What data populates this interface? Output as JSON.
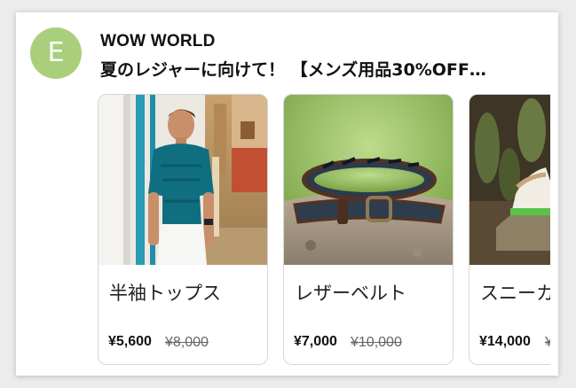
{
  "ad": {
    "avatar_letter": "E",
    "avatar_color": "#a9cf7d",
    "brand": "WOW WORLD",
    "headline": "夏のレジャーに向けて！ 【メンズ用品30%OFF…"
  },
  "products": [
    {
      "name": "半袖トップス",
      "price": "¥5,600",
      "old_price": "¥8,000",
      "image": "man-in-teal-shirt-photo"
    },
    {
      "name": "レザーベルト",
      "price": "¥7,000",
      "old_price": "¥10,000",
      "image": "leather-belt-photo"
    },
    {
      "name": "スニーカー",
      "price": "¥14,000",
      "old_price": "¥",
      "image": "sneaker-photo"
    }
  ]
}
